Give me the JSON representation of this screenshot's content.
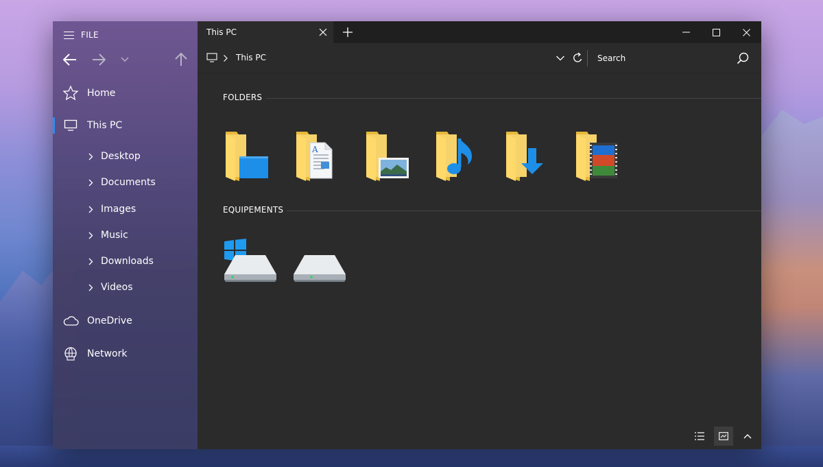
{
  "colors": {
    "accent": "#2c8cf4",
    "window_bg": "#2b2b2b",
    "titlebar_bg": "#1f1f1f",
    "folder_yellow": "#f2c94c",
    "folder_blue": "#1e8fe8"
  },
  "sidebar": {
    "file_label": "FILE",
    "nav": {
      "back_icon": "arrow-left-icon",
      "forward_icon": "arrow-right-icon",
      "recent_icon": "chevron-down-icon",
      "up_icon": "arrow-up-icon"
    },
    "items": [
      {
        "label": "Home",
        "icon": "star-icon"
      },
      {
        "label": "This PC",
        "icon": "computer-icon",
        "active": true
      },
      {
        "label": "OneDrive",
        "icon": "cloud-icon"
      },
      {
        "label": "Network",
        "icon": "network-icon"
      }
    ],
    "children": [
      {
        "label": "Desktop"
      },
      {
        "label": "Documents"
      },
      {
        "label": "Images"
      },
      {
        "label": "Music"
      },
      {
        "label": "Downloads"
      },
      {
        "label": "Videos"
      }
    ]
  },
  "titlebar": {
    "tab_label": "This PC",
    "tab_close_icon": "close-icon",
    "new_tab_icon": "plus-icon",
    "minimize_icon": "minimize-icon",
    "maximize_icon": "maximize-icon",
    "close_icon": "close-icon"
  },
  "address": {
    "crumb": "This PC",
    "search_placeholder": "Search"
  },
  "content": {
    "folders_title": "FOLDERS",
    "devices_title": "EQUIPEMENTS",
    "folders": [
      {
        "icon": "desktop-folder-icon"
      },
      {
        "icon": "documents-folder-icon"
      },
      {
        "icon": "pictures-folder-icon"
      },
      {
        "icon": "music-folder-icon"
      },
      {
        "icon": "downloads-folder-icon"
      },
      {
        "icon": "videos-folder-icon"
      }
    ],
    "drives": [
      {
        "icon": "windows-drive-icon"
      },
      {
        "icon": "drive-icon"
      }
    ]
  },
  "statusbar": {
    "list_view_icon": "list-view-icon",
    "tile_view_icon": "tile-view-icon",
    "collapse_icon": "chevron-up-icon"
  }
}
